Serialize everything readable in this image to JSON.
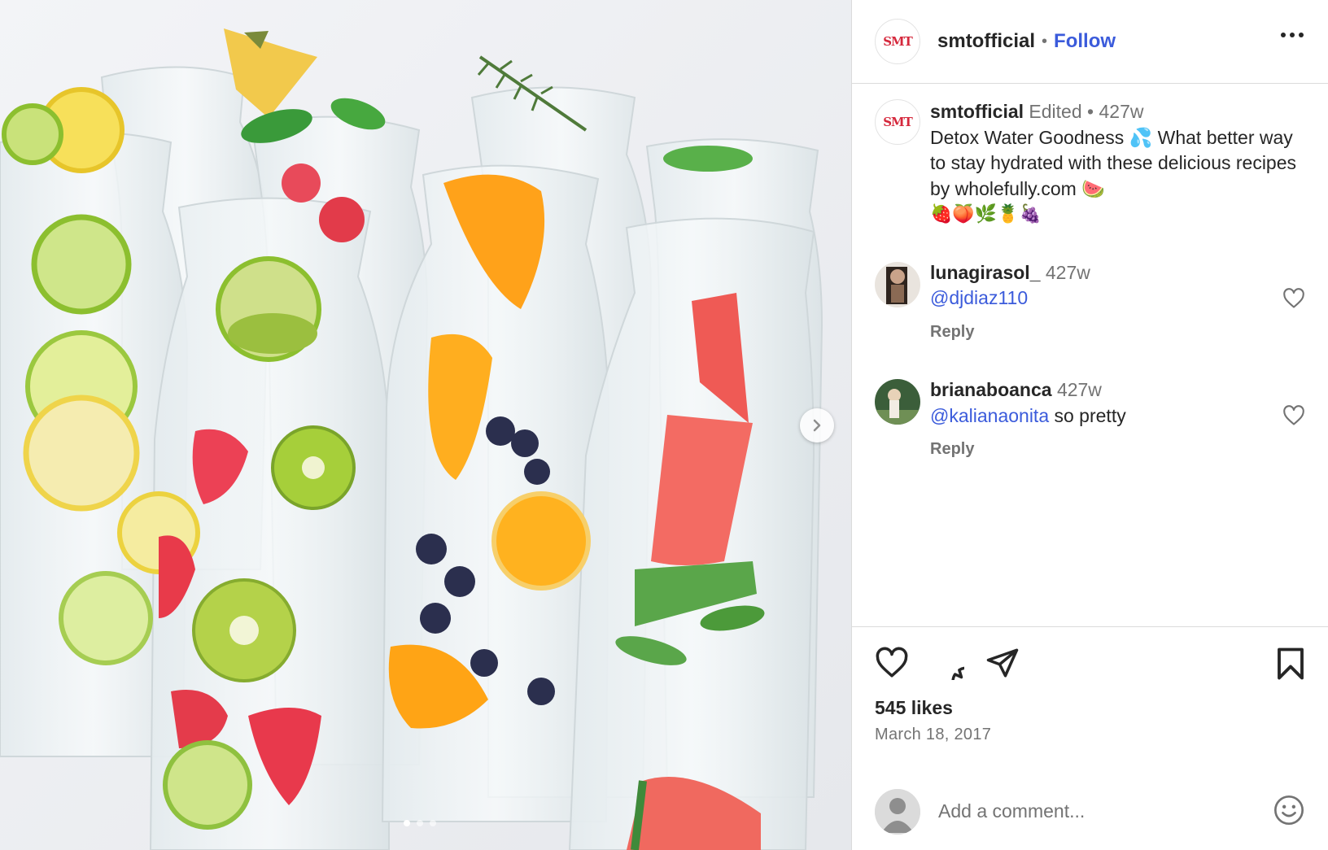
{
  "post": {
    "username": "smtofficial",
    "follow_label": "Follow",
    "avatar_text": "SMT",
    "caption_edited": "Edited",
    "caption_time": "427w",
    "caption_text": "Detox Water Goodness 💦 What better way to stay hydrated with these delicious recipes by wholefully.com 🍉",
    "caption_emojis": "🍓🍑🌿🍍🍇",
    "likes": "545 likes",
    "date": "March 18, 2017"
  },
  "comments": [
    {
      "username": "lunagirasol_",
      "time": "427w",
      "mention": "@djdiaz110",
      "text": "",
      "reply_label": "Reply"
    },
    {
      "username": "brianaboanca",
      "time": "427w",
      "mention": "@kalianaonita",
      "text": " so pretty",
      "reply_label": "Reply"
    }
  ],
  "add_comment": {
    "placeholder": "Add a comment..."
  },
  "carousel": {
    "current": 1,
    "total": 3
  },
  "icons": [
    "more-icon",
    "heart-icon",
    "comment-icon",
    "share-icon",
    "bookmark-icon",
    "chevron-right-icon",
    "smiley-icon"
  ],
  "colors": {
    "link": "#3b5bdb",
    "text": "#262626",
    "muted": "#737373",
    "border": "#dbdbdb"
  }
}
